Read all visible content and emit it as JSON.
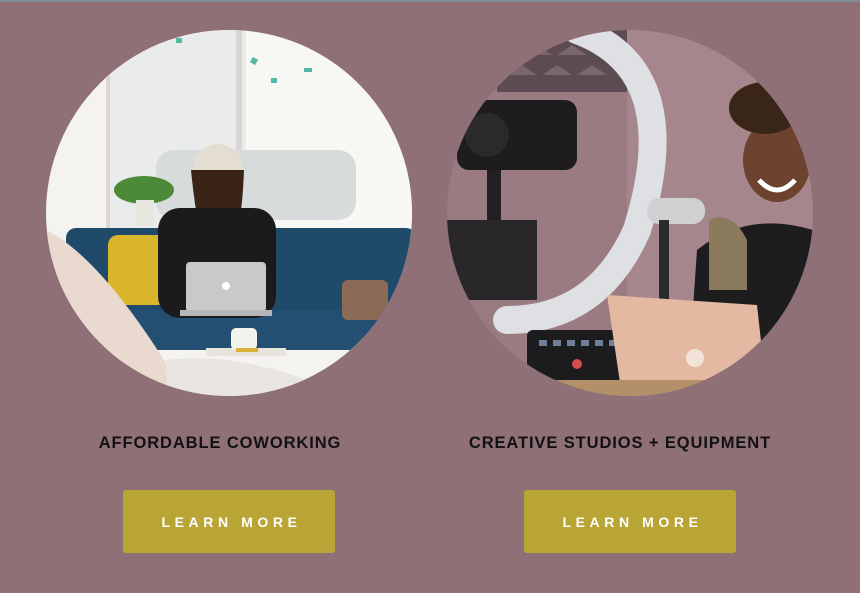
{
  "colors": {
    "background": "#8f7077",
    "button": "#b9a535",
    "button_text": "#ffffff",
    "title_text": "#111111"
  },
  "cards": [
    {
      "title": "AFFORDABLE COWORKING",
      "button_label": "LEARN MORE",
      "image": "woman-with-laptop-on-couch-photo"
    },
    {
      "title": "CREATIVE STUDIOS + EQUIPMENT",
      "button_label": "LEARN MORE",
      "image": "podcast-studio-with-ring-light-photo"
    }
  ]
}
